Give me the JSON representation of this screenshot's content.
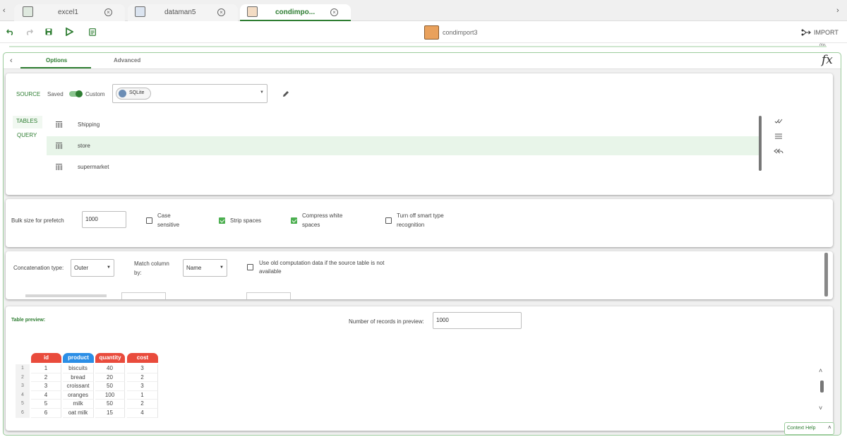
{
  "tabs": [
    {
      "label": "excel1"
    },
    {
      "label": "dataman5"
    },
    {
      "label": "condimpo..."
    }
  ],
  "toolbar": {
    "file_name": "condimport3",
    "import_label": "IMPORT",
    "progress_label": "0%"
  },
  "options": {
    "tabs": [
      {
        "label": "Options"
      },
      {
        "label": "Advanced"
      }
    ],
    "fx_label": "fx"
  },
  "source": {
    "label": "SOURCE",
    "saved_label": "Saved",
    "custom_label": "Custom",
    "selected": "SQLite"
  },
  "tables_panel": {
    "tables_tab": "TABLES",
    "query_tab": "QUERY",
    "tables": [
      {
        "name": "Shipping"
      },
      {
        "name": "store"
      },
      {
        "name": "supermarket"
      }
    ]
  },
  "settings": {
    "bulk_label": "Bulk size for prefetch",
    "bulk_value": "1000",
    "case_sensitive": "Case sensitive",
    "case_sensitive_line1": "Case",
    "case_sensitive_line2": "sensitive",
    "strip_spaces": "Strip spaces",
    "compress_line1": "Compress white",
    "compress_line2": "spaces",
    "smart_line1": "Turn off smart type",
    "smart_line2": "recognition",
    "checked": {
      "case_sensitive": false,
      "strip_spaces": true,
      "compress": true,
      "smart": false
    }
  },
  "concat": {
    "type_label": "Concatenation type:",
    "type_value": "Outer",
    "match_line1": "Match column",
    "match_line2": "by:",
    "match_value": "Name",
    "old_line1": "Use old computation data if the source table is not",
    "old_line2": "available"
  },
  "preview": {
    "title": "Table preview:",
    "records_label": "Number of records in preview:",
    "records_value": "1000",
    "columns": [
      {
        "name": "id",
        "color": "#e94b3c"
      },
      {
        "name": "product",
        "color": "#2b8ee6"
      },
      {
        "name": "quantity",
        "color": "#e94b3c"
      },
      {
        "name": "cost",
        "color": "#e94b3c"
      }
    ],
    "rows": [
      {
        "n": "1",
        "id": "1",
        "product": "biscuits",
        "quantity": "40",
        "cost": "3"
      },
      {
        "n": "2",
        "id": "2",
        "product": "bread",
        "quantity": "20",
        "cost": "2"
      },
      {
        "n": "3",
        "id": "3",
        "product": "croissant",
        "quantity": "50",
        "cost": "3"
      },
      {
        "n": "4",
        "id": "4",
        "product": "oranges",
        "quantity": "100",
        "cost": "1"
      },
      {
        "n": "5",
        "id": "5",
        "product": "milk",
        "quantity": "50",
        "cost": "2"
      },
      {
        "n": "6",
        "id": "6",
        "product": "oat milk",
        "quantity": "15",
        "cost": "4"
      }
    ]
  },
  "context_help": "Context Help",
  "colors": {
    "accent": "#2e7d32",
    "selected_row": "#e8f5e9"
  }
}
